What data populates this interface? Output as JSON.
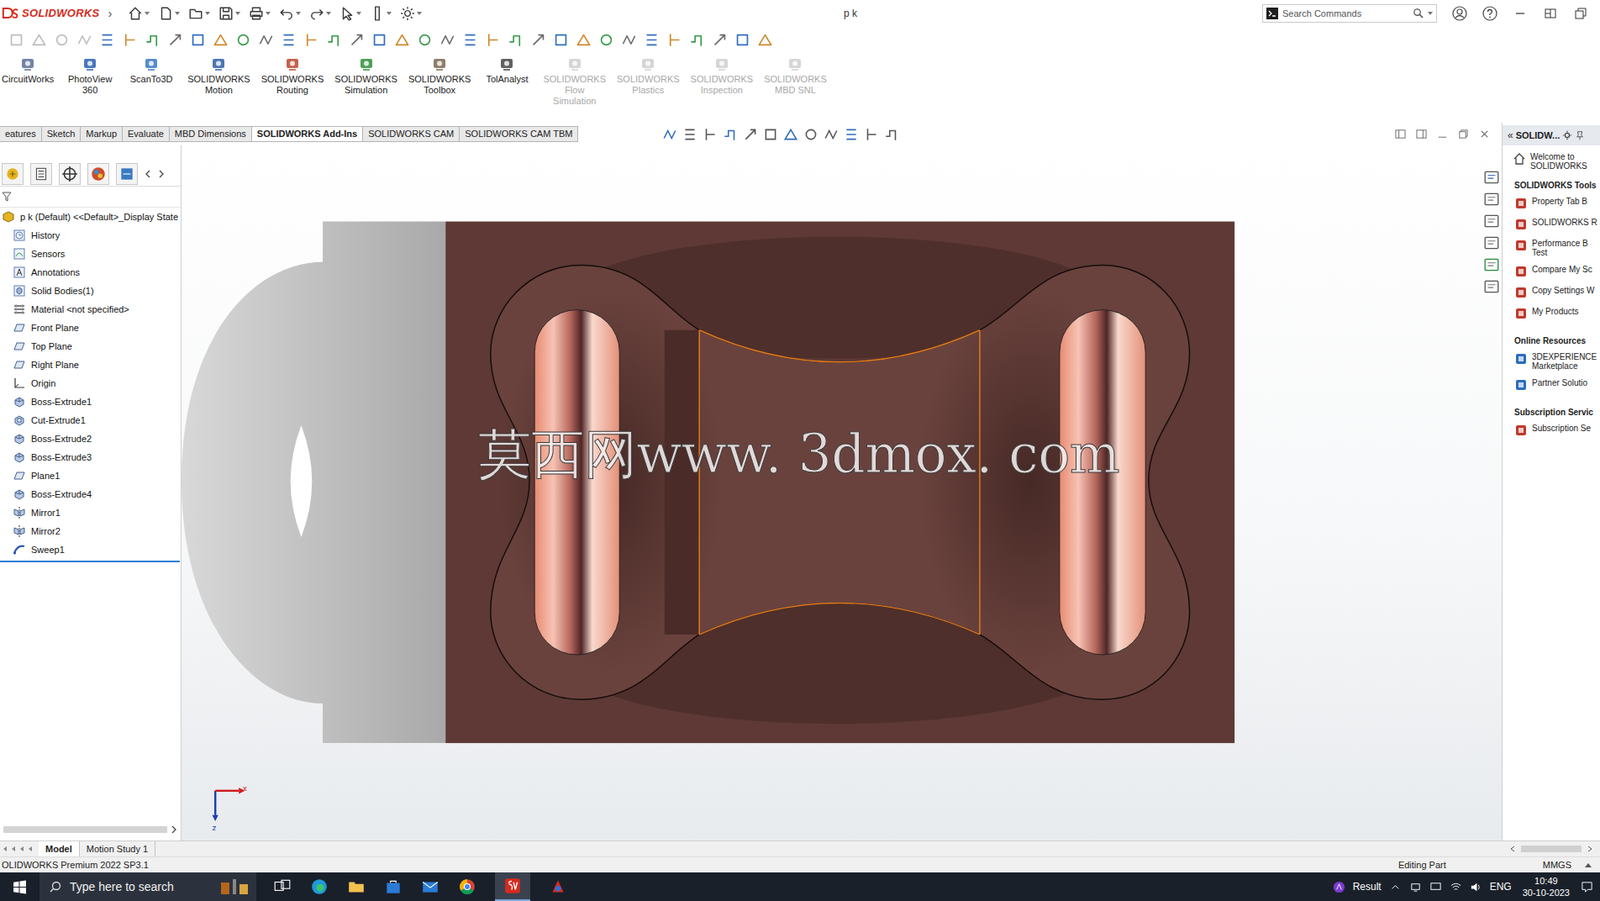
{
  "titlebar": {
    "app": "SOLIDWORKS",
    "arrow": "›",
    "title": "p k",
    "search_placeholder": "Search Commands"
  },
  "commands": [
    {
      "label": [
        "CircuitWorks"
      ],
      "disabled": false
    },
    {
      "label": [
        "PhotoView",
        "360"
      ],
      "disabled": false
    },
    {
      "label": [
        "ScanTo3D"
      ],
      "disabled": false
    },
    {
      "label": [
        "SOLIDWORKS",
        "Motion"
      ],
      "disabled": false
    },
    {
      "label": [
        "SOLIDWORKS",
        "Routing"
      ],
      "disabled": false
    },
    {
      "label": [
        "SOLIDWORKS",
        "Simulation"
      ],
      "disabled": false
    },
    {
      "label": [
        "SOLIDWORKS",
        "Toolbox"
      ],
      "disabled": false
    },
    {
      "label": [
        "TolAnalyst"
      ],
      "disabled": false
    },
    {
      "label": [
        "SOLIDWORKS",
        "Flow",
        "Simulation"
      ],
      "disabled": true
    },
    {
      "label": [
        "SOLIDWORKS",
        "Plastics"
      ],
      "disabled": true
    },
    {
      "label": [
        "SOLIDWORKS",
        "Inspection"
      ],
      "disabled": true
    },
    {
      "label": [
        "SOLIDWORKS",
        "MBD SNL"
      ],
      "disabled": true
    }
  ],
  "tabs": [
    {
      "label": "eatures",
      "selected": false
    },
    {
      "label": "Sketch",
      "selected": false
    },
    {
      "label": "Markup",
      "selected": false
    },
    {
      "label": "Evaluate",
      "selected": false
    },
    {
      "label": "MBD Dimensions",
      "selected": false
    },
    {
      "label": "SOLIDWORKS Add-Ins",
      "selected": true
    },
    {
      "label": "SOLIDWORKS CAM",
      "selected": false
    },
    {
      "label": "SOLIDWORKS CAM TBM",
      "selected": false
    }
  ],
  "feature_tree": {
    "root": "p k (Default) <<Default>_Display State",
    "items": [
      {
        "label": "History",
        "kind": "history"
      },
      {
        "label": "Sensors",
        "kind": "sensors"
      },
      {
        "label": "Annotations",
        "kind": "annotations"
      },
      {
        "label": "Solid Bodies(1)",
        "kind": "bodies"
      },
      {
        "label": "Material <not specified>",
        "kind": "material"
      },
      {
        "label": "Front Plane",
        "kind": "plane"
      },
      {
        "label": "Top Plane",
        "kind": "plane"
      },
      {
        "label": "Right Plane",
        "kind": "plane"
      },
      {
        "label": "Origin",
        "kind": "origin"
      },
      {
        "label": "Boss-Extrude1",
        "kind": "extrude"
      },
      {
        "label": "Cut-Extrude1",
        "kind": "cut"
      },
      {
        "label": "Boss-Extrude2",
        "kind": "extrude"
      },
      {
        "label": "Boss-Extrude3",
        "kind": "extrude"
      },
      {
        "label": "Plane1",
        "kind": "plane"
      },
      {
        "label": "Boss-Extrude4",
        "kind": "extrude"
      },
      {
        "label": "Mirror1",
        "kind": "mirror"
      },
      {
        "label": "Mirror2",
        "kind": "mirror"
      },
      {
        "label": "Sweep1",
        "kind": "sweep"
      }
    ],
    "rollback_bar": true
  },
  "graphics": {
    "watermark": "莫西网www. 3dmox. com",
    "triad": {
      "x": "x",
      "z": "z"
    }
  },
  "task_pane": {
    "chevron": "«",
    "title": "SOLIDW...",
    "welcome": [
      "Welcome to",
      "SOLIDWORKS"
    ],
    "sections": [
      {
        "title": "SOLIDWORKS Tools",
        "items": [
          {
            "lines": [
              "Property Tab B"
            ]
          },
          {
            "lines": [
              "SOLIDWORKS R"
            ]
          },
          {
            "lines": [
              "Performance B",
              "Test"
            ]
          },
          {
            "lines": [
              "Compare My Sc"
            ]
          },
          {
            "lines": [
              "Copy Settings W"
            ]
          },
          {
            "lines": [
              "My Products"
            ]
          }
        ]
      },
      {
        "title": "Online Resources",
        "items": [
          {
            "lines": [
              "3DEXPERIENCE",
              "Marketplace"
            ]
          },
          {
            "lines": [
              "Partner Solutio"
            ]
          }
        ]
      },
      {
        "title": "Subscription Servic",
        "items": [
          {
            "lines": [
              "Subscription Se"
            ]
          }
        ]
      }
    ]
  },
  "bottom_tabs": [
    {
      "label": "Model",
      "selected": true
    },
    {
      "label": "Motion Study 1",
      "selected": false
    }
  ],
  "status_bar": {
    "left": "OLIDWORKS Premium 2022 SP3.1",
    "mode": "Editing Part",
    "units": "MMGS"
  },
  "taskbar": {
    "search": "Type here to search",
    "result": "Result",
    "language": "ENG",
    "time": "10:49",
    "date": "30-10-2023"
  }
}
